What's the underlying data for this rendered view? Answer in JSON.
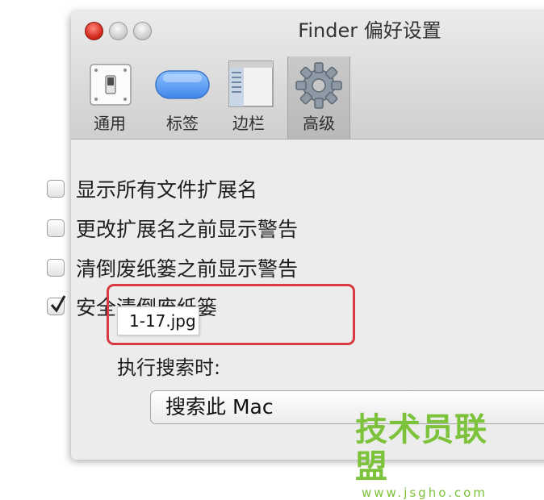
{
  "window": {
    "title": "Finder 偏好设置"
  },
  "toolbar": {
    "items": [
      {
        "label": "通用",
        "icon": "general-switch-icon",
        "selected": false
      },
      {
        "label": "标签",
        "icon": "tags-pill-icon",
        "selected": false
      },
      {
        "label": "边栏",
        "icon": "sidebar-window-icon",
        "selected": false
      },
      {
        "label": "高级",
        "icon": "advanced-gear-icon",
        "selected": true
      }
    ]
  },
  "options": [
    {
      "label": "显示所有文件扩展名",
      "checked": false
    },
    {
      "label": "更改扩展名之前显示警告",
      "checked": false
    },
    {
      "label": "清倒废纸篓之前显示警告",
      "checked": false
    },
    {
      "label": "安全清倒废纸篓",
      "checked": true
    }
  ],
  "drag_label": "1-17.jpg",
  "search": {
    "label": "执行搜索时:",
    "selected": "搜索此 Mac"
  },
  "watermark": {
    "main": "技术员联盟",
    "sub": "www.jsgho.com"
  },
  "colors": {
    "highlight": "#d83a42",
    "watermark": "#7cc23b",
    "close": "#d62b1f"
  }
}
